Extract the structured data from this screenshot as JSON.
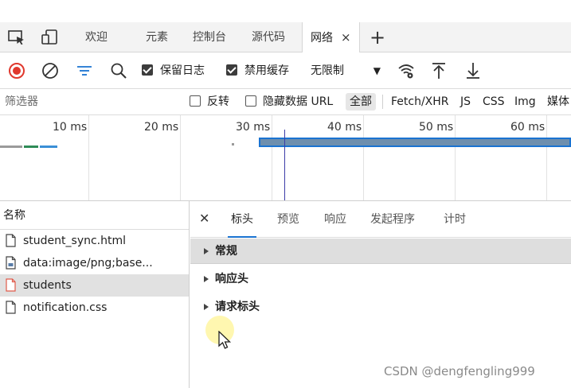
{
  "tabs": {
    "items": [
      {
        "label": "欢迎"
      },
      {
        "label": "元素"
      },
      {
        "label": "控制台"
      },
      {
        "label": "源代码"
      },
      {
        "label": "网络",
        "active": true
      }
    ],
    "close_glyph": "×",
    "add_glyph": "+"
  },
  "toolbar": {
    "preserve_log": "保留日志",
    "disable_cache": "禁用缓存",
    "throttle": "无限制",
    "record_color": "#e0382d"
  },
  "filter": {
    "placeholder": "筛选器",
    "invert": "反转",
    "hide_data_urls": "隐藏数据 URL",
    "all": "全部",
    "types": [
      "Fetch/XHR",
      "JS",
      "CSS",
      "Img",
      "媒体"
    ]
  },
  "timeline": {
    "ticks": [
      "10 ms",
      "20 ms",
      "30 ms",
      "40 ms",
      "50 ms",
      "60 ms"
    ]
  },
  "requests": {
    "header": "名称",
    "rows": [
      {
        "name": "student_sync.html",
        "selected": false
      },
      {
        "name": "data:image/png;base...",
        "selected": false
      },
      {
        "name": "students",
        "selected": true
      },
      {
        "name": "notification.css",
        "selected": false
      }
    ]
  },
  "detail": {
    "close_glyph": "✕",
    "tabs": [
      "标头",
      "预览",
      "响应",
      "发起程序",
      "计时"
    ],
    "sections": [
      "常规",
      "响应头",
      "请求标头"
    ]
  },
  "watermark": "CSDN @dengfengling999"
}
